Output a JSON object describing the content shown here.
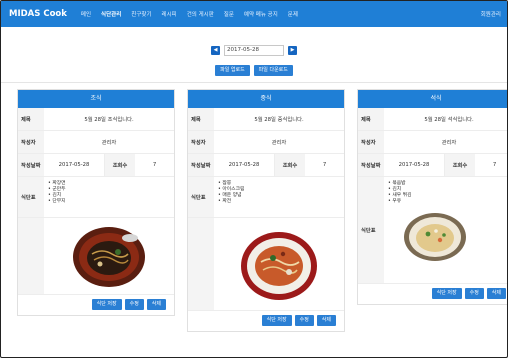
{
  "navbar": {
    "brand": "MIDAS Cook",
    "items": [
      "메인",
      "식단관리",
      "친구찾기",
      "레시피",
      "건의 게시판",
      "질문",
      "예약 메뉴 공지",
      "문제"
    ],
    "right": "회원관리"
  },
  "date_picker": {
    "prev": "◀",
    "date": "2017-05-28",
    "next": "▶"
  },
  "actions": {
    "upload": "파일 업로드",
    "download": "파일 다운로드"
  },
  "labels": {
    "title": "제목",
    "author": "작성자",
    "date": "작성날짜",
    "views": "조회수",
    "menu": "식단표"
  },
  "buttons": {
    "save": "식단 저장",
    "edit": "수정",
    "delete": "삭제"
  },
  "cards": [
    {
      "header": "조식",
      "title": "5월 28일 조식입니다.",
      "author": "관리자",
      "date": "2017-05-28",
      "views": "7",
      "menu": [
        "짜장면",
        "군만두",
        "김치",
        "단무지"
      ]
    },
    {
      "header": "중식",
      "title": "5월 28일 중식입니다.",
      "author": "관리자",
      "date": "2017-05-28",
      "views": "7",
      "menu": [
        "짬뽕",
        "아이스크림",
        "매운 양념",
        "짜전"
      ]
    },
    {
      "header": "석식",
      "title": "5월 28일 석식입니다.",
      "author": "관리자",
      "date": "2017-05-28",
      "views": "7",
      "menu": [
        "볶음밥",
        "김치",
        "새우 튀김",
        "우유"
      ]
    }
  ],
  "colors": {
    "primary": "#1f7fd6",
    "button": "#2a7fd4"
  }
}
